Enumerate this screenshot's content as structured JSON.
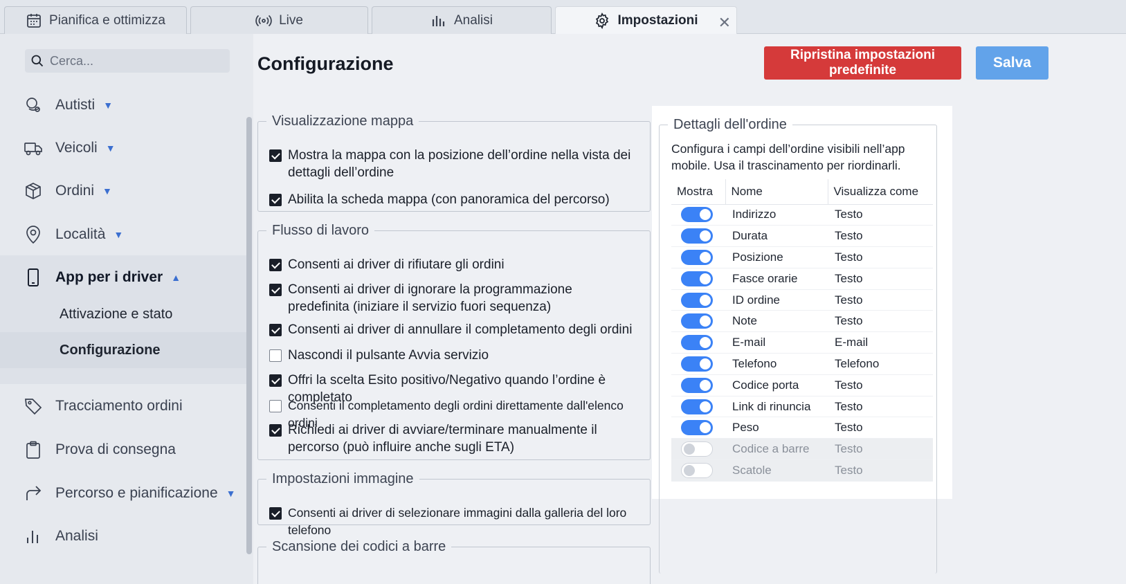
{
  "tabs": [
    {
      "label": "Pianifica e ottimizza",
      "icon": "calendar-icon"
    },
    {
      "label": "Live",
      "icon": "broadcast-icon"
    },
    {
      "label": "Analisi",
      "icon": "bar-chart-icon"
    },
    {
      "label": "Impostazioni",
      "icon": "gear-icon",
      "active": true
    }
  ],
  "tab_close": "✕",
  "search": {
    "placeholder": "Cerca..."
  },
  "sidebar": {
    "items": [
      {
        "label": "Autisti",
        "icon": "drivers-icon"
      },
      {
        "label": "Veicoli",
        "icon": "truck-icon"
      },
      {
        "label": "Ordini",
        "icon": "package-icon"
      },
      {
        "label": "Località",
        "icon": "location-pin-icon"
      },
      {
        "label": "App per i driver",
        "icon": "phone-icon"
      },
      {
        "label": "Tracciamento ordini",
        "icon": "tag-icon"
      },
      {
        "label": "Prova di consegna",
        "icon": "clipboard-icon"
      },
      {
        "label": "Percorso e pianificazione",
        "icon": "route-arrow-icon"
      },
      {
        "label": "Analisi",
        "icon": "bar-chart-icon"
      }
    ],
    "subitems": [
      {
        "label": "Attivazione e stato"
      },
      {
        "label": "Configurazione",
        "selected": true
      }
    ]
  },
  "main": {
    "title": "Configurazione",
    "reset_label": "Ripristina impostazioni predefinite",
    "save_label": "Salva",
    "reset_color": "#d53a3a",
    "save_color": "#62a3ea",
    "sections": {
      "map": {
        "legend": "Visualizzazione mappa",
        "options": [
          {
            "label": "Mostra la mappa con la posizione dell’ordine nella vista dei dettagli dell’ordine",
            "checked": true
          },
          {
            "label": "Abilita la scheda mappa (con panoramica del percorso)",
            "checked": true
          }
        ]
      },
      "workflow": {
        "legend": "Flusso di lavoro",
        "options": [
          {
            "label": "Consenti ai driver di rifiutare gli ordini",
            "checked": true
          },
          {
            "label": "Consenti ai driver di ignorare la programmazione predefinita (iniziare il servizio fuori sequenza)",
            "checked": true
          },
          {
            "label": "Consenti ai driver di annullare il completamento degli ordini",
            "checked": true
          },
          {
            "label": "Nascondi il pulsante Avvia servizio",
            "checked": false
          },
          {
            "label": "Offri la scelta Esito positivo/Negativo quando l’ordine è completato",
            "checked": true
          },
          {
            "label": "Consenti il completamento degli ordini direttamente dall'elenco ordini",
            "checked": false
          },
          {
            "label": "Richiedi ai driver di avviare/terminare manualmente il percorso (può influire anche sugli ETA)",
            "checked": true
          }
        ]
      },
      "image": {
        "legend": "Impostazioni immagine",
        "options": [
          {
            "label": "Consenti ai driver di selezionare immagini dalla galleria del loro telefono",
            "checked": true
          }
        ]
      },
      "barcode": {
        "legend": "Scansione dei codici a barre"
      }
    },
    "details": {
      "legend": "Dettagli dell'ordine",
      "description": "Configura i campi dell’ordine visibili nell’app mobile. Usa il trascinamento per riordinarli.",
      "columns": [
        "Mostra",
        "Nome",
        "Visualizza come"
      ],
      "rows": [
        {
          "name": "Indirizzo",
          "display": "Testo",
          "shown": true
        },
        {
          "name": "Durata",
          "display": "Testo",
          "shown": true
        },
        {
          "name": "Posizione",
          "display": "Testo",
          "shown": true
        },
        {
          "name": "Fasce orarie",
          "display": "Testo",
          "shown": true
        },
        {
          "name": "ID ordine",
          "display": "Testo",
          "shown": true
        },
        {
          "name": "Note",
          "display": "Testo",
          "shown": true
        },
        {
          "name": "E-mail",
          "display": "E-mail",
          "shown": true
        },
        {
          "name": "Telefono",
          "display": "Telefono",
          "shown": true
        },
        {
          "name": "Codice porta",
          "display": "Testo",
          "shown": true
        },
        {
          "name": "Link di rinuncia",
          "display": "Testo",
          "shown": true
        },
        {
          "name": "Peso",
          "display": "Testo",
          "shown": true
        },
        {
          "name": "Codice a barre",
          "display": "Testo",
          "shown": false
        },
        {
          "name": "Scatole",
          "display": "Testo",
          "shown": false
        }
      ]
    }
  }
}
